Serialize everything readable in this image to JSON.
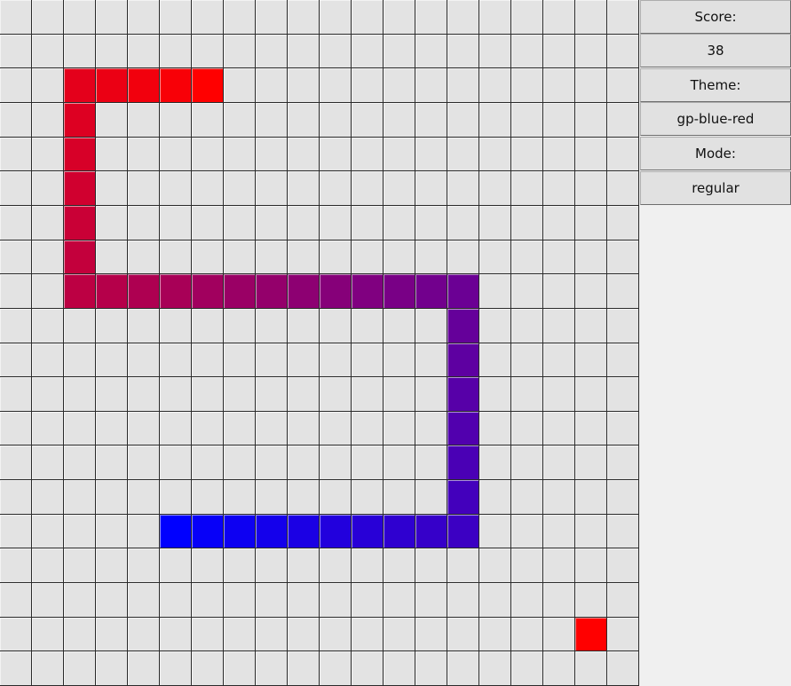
{
  "board": {
    "cols": 20,
    "rows": 20,
    "snake_head_color": "#ff0000",
    "snake_tail_color": "#0000ff",
    "food_color": "#ff0000",
    "cell_bg": "#e3e3e3",
    "grid_line": "#2a2a2a",
    "snake": [
      [
        6,
        2
      ],
      [
        5,
        2
      ],
      [
        4,
        2
      ],
      [
        3,
        2
      ],
      [
        2,
        2
      ],
      [
        2,
        3
      ],
      [
        2,
        4
      ],
      [
        2,
        5
      ],
      [
        2,
        6
      ],
      [
        2,
        7
      ],
      [
        2,
        8
      ],
      [
        3,
        8
      ],
      [
        4,
        8
      ],
      [
        5,
        8
      ],
      [
        6,
        8
      ],
      [
        7,
        8
      ],
      [
        8,
        8
      ],
      [
        9,
        8
      ],
      [
        10,
        8
      ],
      [
        11,
        8
      ],
      [
        12,
        8
      ],
      [
        13,
        8
      ],
      [
        14,
        8
      ],
      [
        14,
        9
      ],
      [
        14,
        10
      ],
      [
        14,
        11
      ],
      [
        14,
        12
      ],
      [
        14,
        13
      ],
      [
        14,
        14
      ],
      [
        14,
        15
      ],
      [
        13,
        15
      ],
      [
        12,
        15
      ],
      [
        11,
        15
      ],
      [
        10,
        15
      ],
      [
        9,
        15
      ],
      [
        8,
        15
      ],
      [
        7,
        15
      ],
      [
        6,
        15
      ],
      [
        5,
        15
      ]
    ],
    "food": [
      18,
      18
    ]
  },
  "sidebar": {
    "score_label": "Score:",
    "score_value": "38",
    "theme_label": "Theme:",
    "theme_value": "gp-blue-red",
    "mode_label": "Mode:",
    "mode_value": "regular"
  }
}
